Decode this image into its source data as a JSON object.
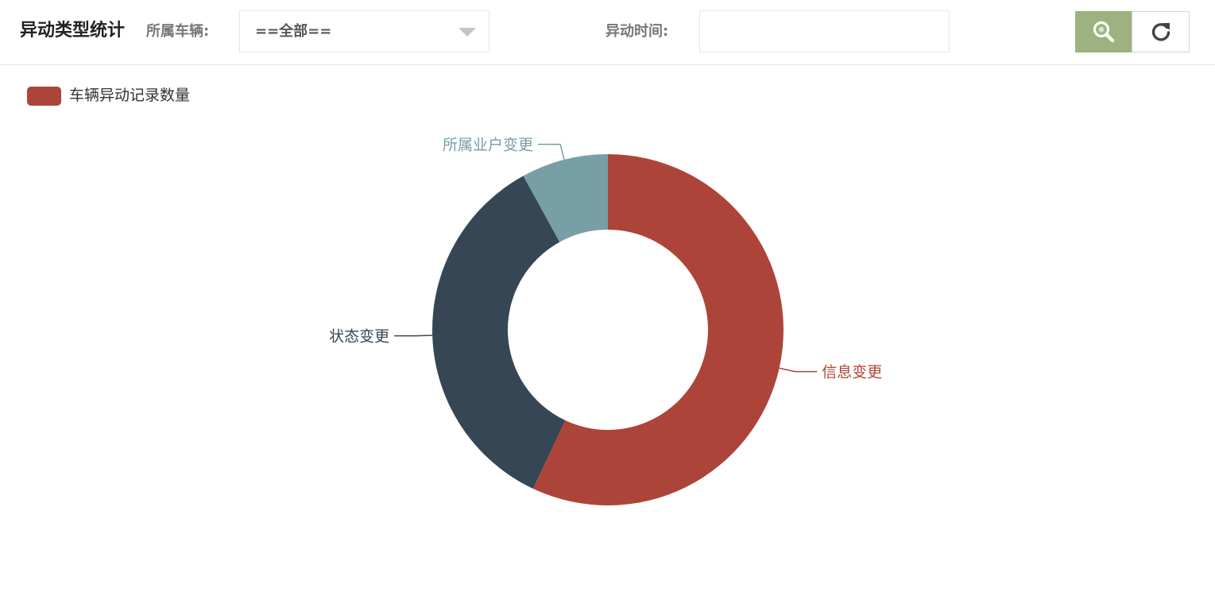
{
  "header": {
    "title": "异动类型统计",
    "vehicle_label": "所属车辆:",
    "vehicle_select_value": "==全部==",
    "time_label": "异动时间:",
    "time_value": "",
    "time_placeholder": ""
  },
  "icons": {
    "search": "search-icon",
    "refresh": "refresh-icon",
    "dropdown": "chevron-down-icon"
  },
  "colors": {
    "search_button": "#9db27f",
    "legend_swatch": "#ad443a"
  },
  "chart_data": {
    "type": "pie",
    "variant": "donut",
    "legend": [
      "车辆异动记录数量"
    ],
    "legend_position": "top-left",
    "series": [
      {
        "name": "车辆异动记录数量",
        "slices": [
          {
            "label": "信息变更",
            "value": 57,
            "color": "#ad443a"
          },
          {
            "label": "状态变更",
            "value": 35,
            "color": "#364655"
          },
          {
            "label": "所属业户变更",
            "value": 8,
            "color": "#789ea6"
          }
        ]
      }
    ]
  }
}
